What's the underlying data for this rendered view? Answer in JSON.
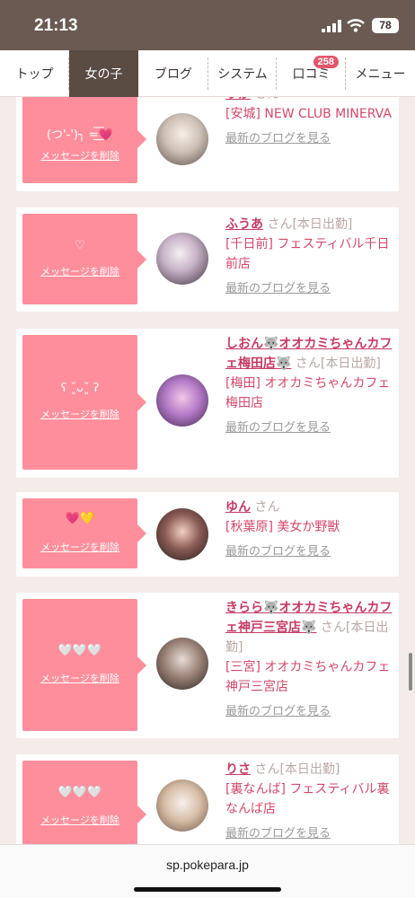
{
  "status_bar": {
    "time": "21:13",
    "battery": "78"
  },
  "nav": {
    "tabs": [
      {
        "label": "トップ"
      },
      {
        "label": "女の子"
      },
      {
        "label": "ブログ"
      },
      {
        "label": "システム"
      },
      {
        "label": "口コミ",
        "badge": "258"
      },
      {
        "label": "メニュー"
      }
    ],
    "active_tab": "女の子"
  },
  "cards": [
    {
      "message": "(つ'-')╮ =͟͟͞͞💗",
      "delete_label": "メッセージを削除",
      "name": "りか",
      "san": "さん",
      "shop": "[安城] NEW CLUB MINERVA",
      "blog_link": "最新のブログを見る"
    },
    {
      "message": "♡",
      "delete_label": "メッセージを削除",
      "name": "ふうあ",
      "san": "さん[本日出勤]",
      "shop": "[千日前] フェスティバル千日前店",
      "blog_link": "最新のブログを見る"
    },
    {
      "message": "ʕ ˘͈ᴗ˘͈ ʔ",
      "delete_label": "メッセージを削除",
      "name": "しおん🐺オオカミちゃんカフェ梅田店🐺",
      "san": "さん[本日出勤]",
      "shop": "[梅田] オオカミちゃんカフェ梅田店",
      "blog_link": "最新のブログを見る"
    },
    {
      "message": "💗💛",
      "delete_label": "メッセージを削除",
      "name": "ゆん",
      "san": "さん",
      "shop": "[秋葉原] 美女か野獣",
      "blog_link": "最新のブログを見る"
    },
    {
      "message": "🤍🤍🤍",
      "delete_label": "メッセージを削除",
      "name": "きらら🐺オオカミちゃんカフェ神戸三宮店🐺",
      "san": "さん[本日出勤]",
      "shop": "[三宮] オオカミちゃんカフェ神戸三宮店",
      "blog_link": "最新のブログを見る"
    },
    {
      "message": "🤍🤍🤍",
      "delete_label": "メッセージを削除",
      "name": "りさ",
      "san": "さん[本日出勤]",
      "shop": "[裏なんば] フェスティバル裏なんば店",
      "blog_link": "最新のブログを見る"
    }
  ],
  "browser": {
    "url": "sp.pokepara.jp"
  },
  "colors": {
    "accent": "#ff8e9c",
    "link": "#d3486a",
    "nav_active": "#5a4b43",
    "badge": "#e5566b"
  }
}
